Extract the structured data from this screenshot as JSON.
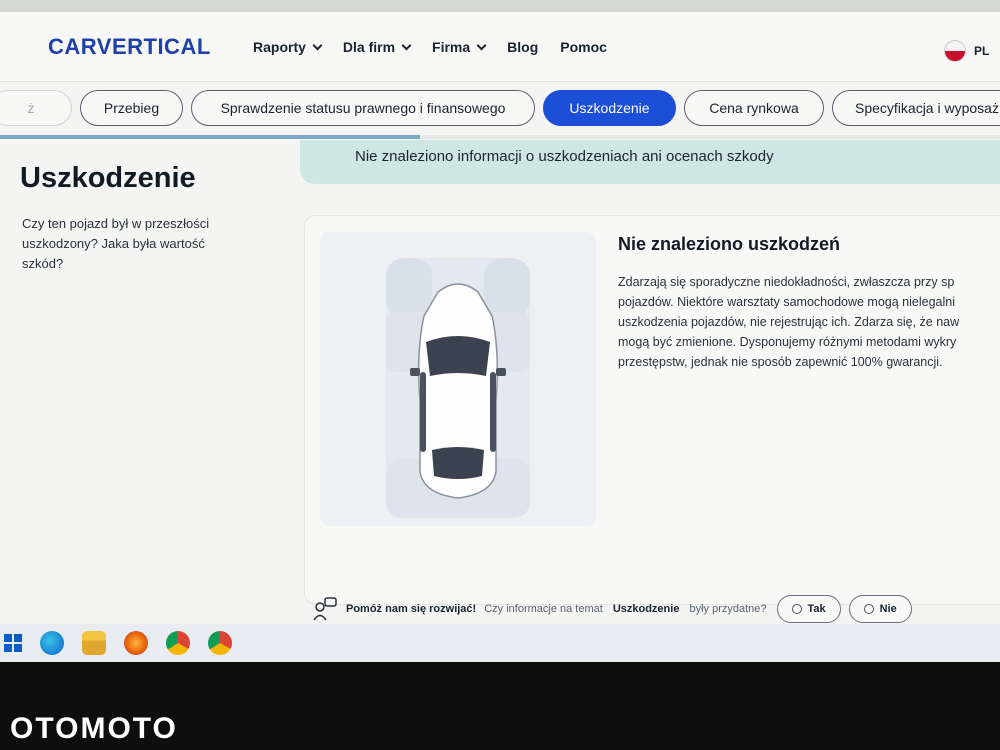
{
  "header": {
    "logo": "CARVERTICAL",
    "nav": [
      {
        "label": "Raporty",
        "dropdown": true
      },
      {
        "label": "Dla firm",
        "dropdown": true
      },
      {
        "label": "Firma",
        "dropdown": true
      },
      {
        "label": "Blog",
        "dropdown": false
      },
      {
        "label": "Pomoc",
        "dropdown": false
      }
    ],
    "lang": "PL"
  },
  "tabs": [
    {
      "label": "ż",
      "active": false
    },
    {
      "label": "Przebieg",
      "active": false
    },
    {
      "label": "Sprawdzenie statusu prawnego i finansowego",
      "active": false
    },
    {
      "label": "Uszkodzenie",
      "active": true
    },
    {
      "label": "Cena rynkowa",
      "active": false
    },
    {
      "label": "Specyfikacja i wyposaż",
      "active": false
    }
  ],
  "section": {
    "title": "Uszkodzenie",
    "description": "Czy ten pojazd był w przeszłości uszkodzony? Jaka była wartość szkód?"
  },
  "banner": "Nie znaleziono informacji o uszkodzeniach ani ocenach szkody",
  "result": {
    "title": "Nie znaleziono uszkodzeń",
    "lines": [
      "Zdarzają się sporadyczne niedokładności, zwłaszcza przy sp",
      "pojazdów. Niektóre warsztaty samochodowe mogą nielegalni",
      "uszkodzenia pojazdów, nie rejestrując ich. Zdarza się, że naw",
      "mogą być zmienione. Dysponujemy różnymi metodami wykry",
      "przestępstw, jednak nie sposób zapewnić 100% gwarancji."
    ]
  },
  "feedback": {
    "lead": "Pomóż nam się rozwijać!",
    "question_before": "Czy informacje na temat",
    "topic": "Uszkodzenie",
    "question_after": "były przydatne?",
    "yes": "Tak",
    "no": "Nie"
  },
  "watermark": "OTOMOTO",
  "colors": {
    "brand": "#1e40a8",
    "active_tab": "#1d4ed8",
    "banner": "#cfe7e2"
  }
}
